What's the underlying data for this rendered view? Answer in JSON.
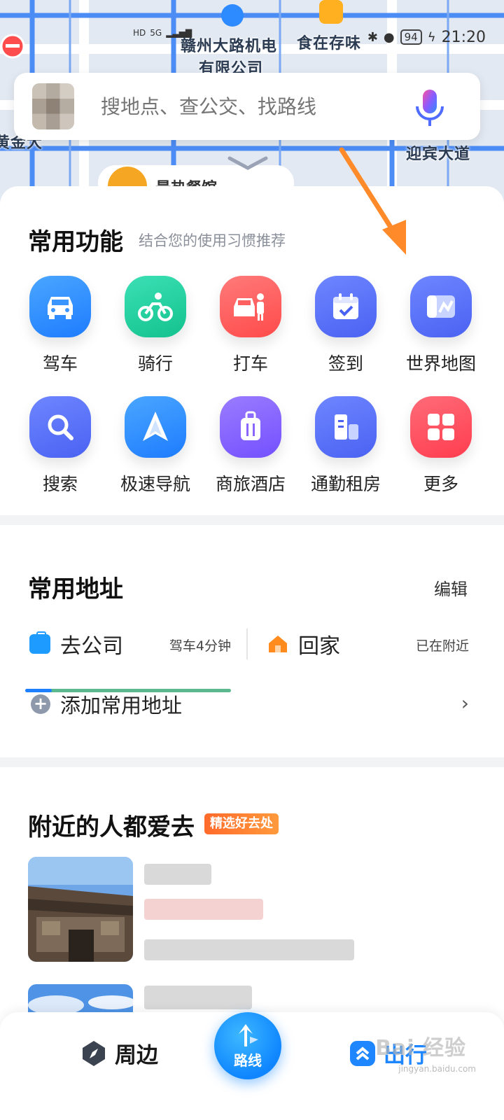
{
  "status_bar": {
    "time": "21:20",
    "battery": "94",
    "network": "5G"
  },
  "map": {
    "labels": [
      "赣州大路机电",
      "有限公司",
      "食在存味",
      "迎宾大道",
      "黄金大"
    ],
    "peek_label": "最热餐馆"
  },
  "search": {
    "placeholder": "搜地点、查公交、找路线"
  },
  "common_functions": {
    "title": "常用功能",
    "subtitle": "结合您的使用习惯推荐",
    "items": [
      {
        "label": "驾车",
        "icon": "car-icon",
        "color": "#2d8bff"
      },
      {
        "label": "骑行",
        "icon": "bike-icon",
        "color": "#1fcfa0"
      },
      {
        "label": "打车",
        "icon": "taxi-icon",
        "color": "#ff5a5a"
      },
      {
        "label": "签到",
        "icon": "calendar-check-icon",
        "color": "#4f6cff"
      },
      {
        "label": "世界地图",
        "icon": "world-map-icon",
        "color": "#4f6cff"
      },
      {
        "label": "搜索",
        "icon": "search-icon",
        "color": "#4f6cff"
      },
      {
        "label": "极速导航",
        "icon": "navigation-arrow-icon",
        "color": "#2d8bff"
      },
      {
        "label": "商旅酒店",
        "icon": "luggage-icon",
        "color": "#7b5cff"
      },
      {
        "label": "通勤租房",
        "icon": "building-icon",
        "color": "#4f6cff"
      },
      {
        "label": "更多",
        "icon": "grid-more-icon",
        "color": "#ff4d5e"
      }
    ]
  },
  "addresses": {
    "title": "常用地址",
    "edit": "编辑",
    "company": {
      "name": "去公司",
      "eta": "驾车4分钟"
    },
    "home": {
      "name": "回家",
      "eta": "已在附近"
    },
    "add": "添加常用地址"
  },
  "nearby": {
    "title": "附近的人都爱去",
    "badge": "精选好去处"
  },
  "bottom_nav": {
    "around": "周边",
    "route": "路线",
    "travel": "出行"
  },
  "watermark": {
    "brand": "Bai 经验",
    "url": "jingyan.baidu.com"
  }
}
